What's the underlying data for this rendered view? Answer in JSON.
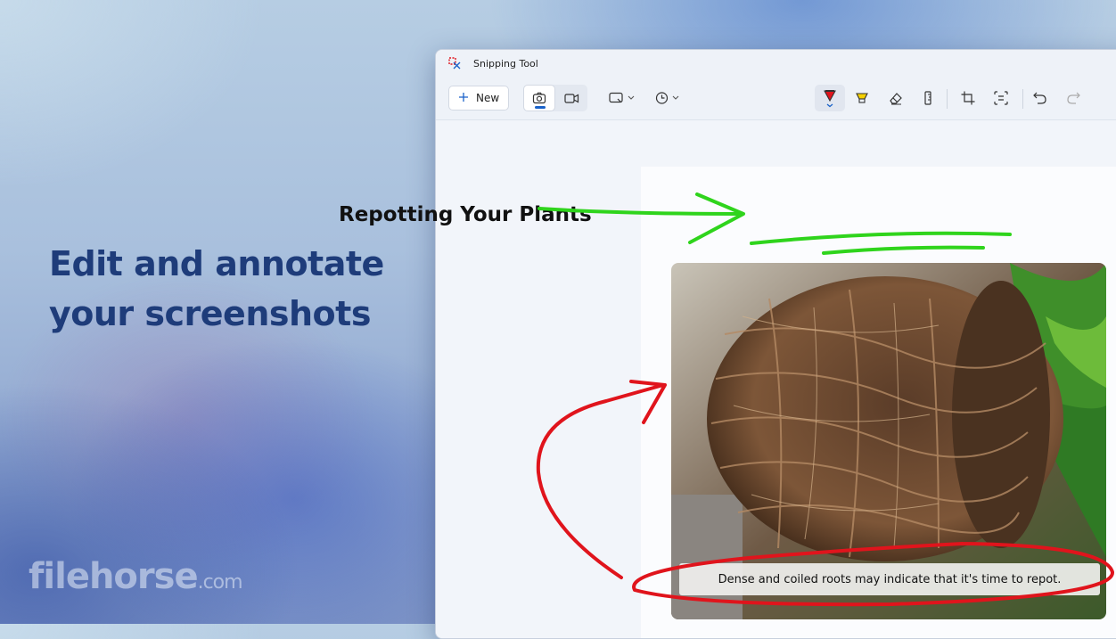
{
  "promo": {
    "headline_line1": "Edit and annotate",
    "headline_line2": "your screenshots"
  },
  "watermark": {
    "brand": "filehorse",
    "suffix": ".com"
  },
  "window": {
    "title": "Snipping Tool"
  },
  "toolbar": {
    "new_label": "New",
    "icons": [
      "camera-icon",
      "video-icon",
      "snip-mode-icon",
      "delay-icon",
      "ballpoint-pen-icon",
      "highlighter-icon",
      "eraser-icon",
      "ruler-icon",
      "crop-icon",
      "text-actions-icon",
      "undo-icon",
      "redo-icon"
    ]
  },
  "document": {
    "title": "Repotting Your Plants",
    "caption": "Dense and coiled roots may indicate that it's time to repot."
  },
  "colors": {
    "accent": "#1a62c9",
    "headline": "#1e3c7a",
    "green_ink": "#2fd41c",
    "red_ink": "#e0141c"
  }
}
